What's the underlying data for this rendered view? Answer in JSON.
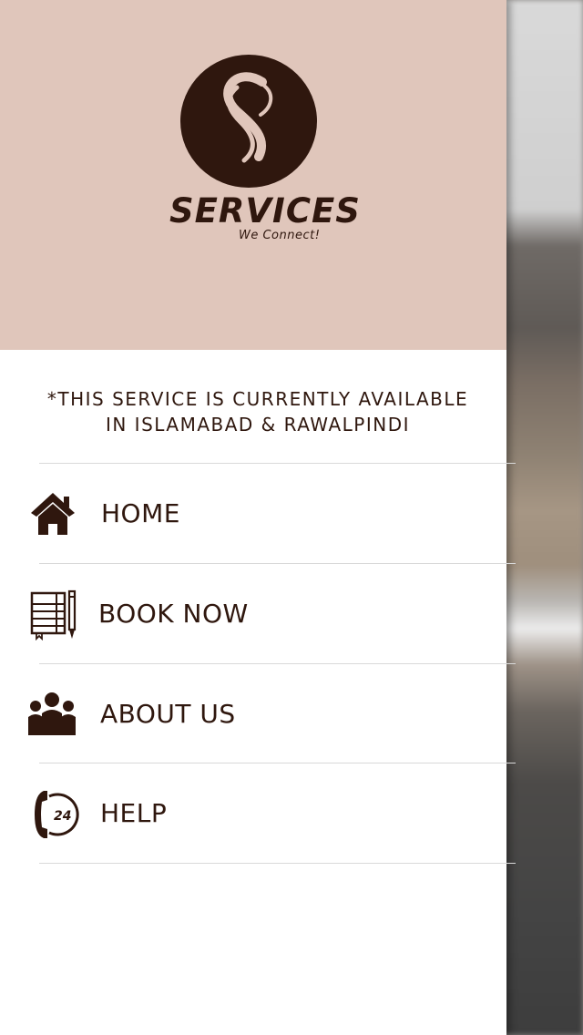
{
  "header": {
    "brand_name": "SERVICES",
    "tagline": "We Connect!",
    "logo_icon": "s-monogram-logo"
  },
  "notice": {
    "line1": "*THIS SERVICE IS CURRENTLY AVAILABLE",
    "line2": "IN ISLAMABAD & RAWALPINDI"
  },
  "menu": {
    "items": [
      {
        "label": "HOME",
        "icon": "home-icon"
      },
      {
        "label": "BOOK NOW",
        "icon": "notebook-pencil-icon"
      },
      {
        "label": "ABOUT US",
        "icon": "group-icon"
      },
      {
        "label": "HELP",
        "icon": "phone-24-icon"
      }
    ]
  },
  "colors": {
    "header_bg": "#e0c6bb",
    "brand_dark": "#2f170e",
    "drawer_bg": "#ffffff",
    "divider": "#d9d9d9"
  }
}
